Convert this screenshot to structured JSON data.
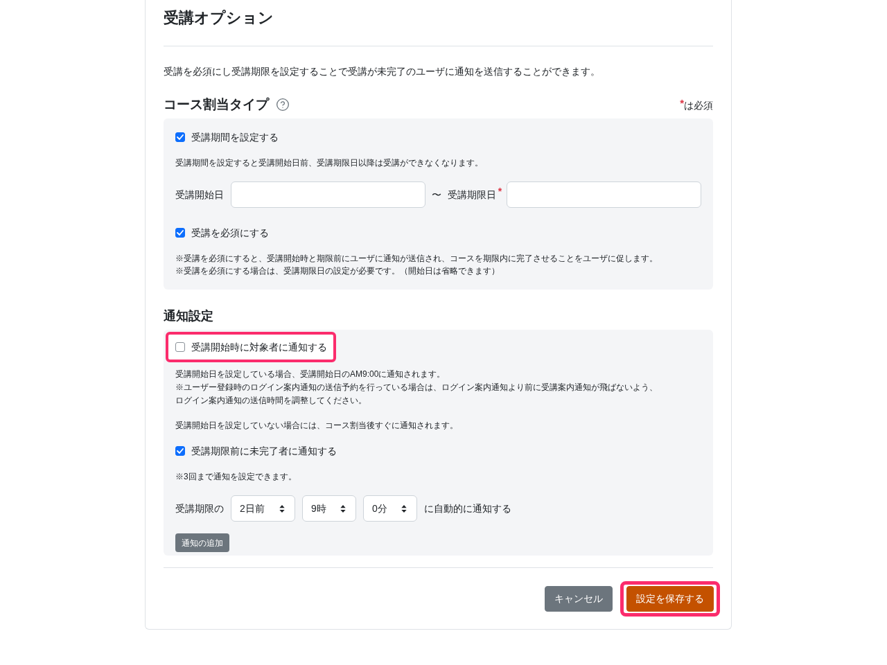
{
  "page": {
    "title": "受講オプション",
    "description": "受講を必須にし受講期限を設定することで受講が未完了のユーザに通知を送信することができます。"
  },
  "course_assignment": {
    "heading": "コース割当タイプ",
    "required_note": {
      "mark": "*",
      "text": "は必須"
    },
    "period_option": {
      "label": "受講期間を設定する",
      "checked": true
    },
    "period_note": "受講期間を設定すると受講開始日前、受講期限日以降は受講ができなくなります。",
    "start_date": {
      "label": "受講開始日"
    },
    "range_separator": "〜",
    "end_date": {
      "label": "受講期限日",
      "required_mark": "*"
    },
    "mandatory_option": {
      "label": "受講を必須にする",
      "checked": true
    },
    "mandatory_notes": [
      "※受講を必須にすると、受講開始時と期限前にユーザに通知が送信され、コースを期限内に完了させることをユーザに促します。",
      "※受講を必須にする場合は、受講期限日の設定が必要です。（開始日は省略できます）"
    ]
  },
  "notification": {
    "heading": "通知設定",
    "start_option": {
      "label": "受講開始時に対象者に通知する",
      "checked": false,
      "highlighted": true
    },
    "start_notes": [
      "受講開始日を設定している場合、受講開始日のAM9:00に通知されます。",
      "※ユーザー登録時のログイン案内通知の送信予約を行っている場合は、ログイン案内通知より前に受講案内通知が飛ばないよう、",
      "ログイン案内通知の送信時間を調整してください。"
    ],
    "no_start_note": "受講開始日を設定していない場合には、コース割当後すぐに通知されます。",
    "deadline_option": {
      "label": "受講期限前に未完了者に通知する",
      "checked": true
    },
    "deadline_note": "※3回まで通知を設定できます。",
    "schedule": {
      "prefix": "受講期限の",
      "selects": [
        "2日前",
        "9時",
        "0分"
      ],
      "suffix": "に自動的に通知する"
    },
    "add_button": "通知の追加"
  },
  "footer": {
    "buttons": [
      {
        "label": "キャンセル",
        "kind": "secondary",
        "highlighted": false
      },
      {
        "label": "設定を保存する",
        "kind": "primary",
        "highlighted": true
      }
    ]
  }
}
